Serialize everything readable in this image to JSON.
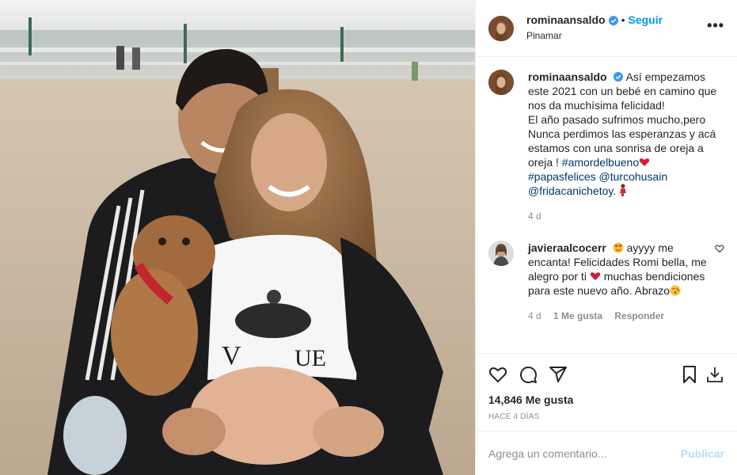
{
  "header": {
    "username": "rominaansaldo",
    "follow_label": "Seguir",
    "separator": "•",
    "location": "Pinamar",
    "more_label": "•••"
  },
  "caption": {
    "username": "rominaansaldo",
    "text_1": "Así empezamos este 2021 con un bebé en camino que nos da muchísima felicidad!",
    "text_2": "El año pasado sufrimos mucho,pero Nunca perdimos las esperanzas y acá estamos con una sonrisa de oreja a oreja !",
    "hashtag_1": "#amordelbueno",
    "hashtag_2": "#papasfelices",
    "mention_1": "@turcohusain",
    "mention_2": "@fridacanichetoy",
    "time": "4 d"
  },
  "comment": {
    "username": "javieraalcocerr",
    "text_1": "ayyyy me encanta! Felicidades Romi bella, me alegro por ti",
    "text_2": "muchas bendiciones para este nuevo año. Abrazo",
    "time": "4 d",
    "likes": "1 Me gusta",
    "reply_label": "Responder"
  },
  "stats": {
    "likes": "14,846 Me gusta",
    "date": "HACE 4 DÍAS"
  },
  "add_comment": {
    "placeholder": "Agrega un comentario...",
    "publish_label": "Publicar"
  },
  "colors": {
    "link": "#0095f6",
    "hashtag": "#00376b",
    "muted": "#8e8e8e",
    "publish_disabled": "#b2dffc"
  },
  "icons": [
    "verified-badge-icon",
    "more-icon",
    "heart-icon",
    "comment-icon",
    "share-icon",
    "save-icon",
    "download-icon",
    "small-heart-icon"
  ]
}
